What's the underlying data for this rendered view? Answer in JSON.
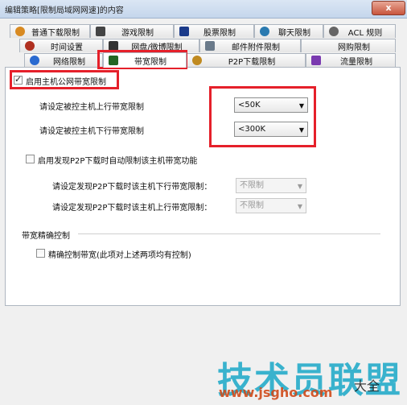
{
  "window": {
    "title": "编辑策略[限制局域网网速]的内容",
    "close_label": "x"
  },
  "tabs_row1": [
    {
      "label": "普通下载限制",
      "icon": "download-icon",
      "color": "#d88a22"
    },
    {
      "label": "游戏限制",
      "icon": "game-icon",
      "color": "#444"
    },
    {
      "label": "股票限制",
      "icon": "stock-icon",
      "color": "#1a3a8a"
    },
    {
      "label": "聊天限制",
      "icon": "chat-icon",
      "color": "#2a7ab0"
    },
    {
      "label": "ACL 规则",
      "icon": "acl-icon",
      "color": "#666"
    }
  ],
  "tabs_row2": [
    {
      "label": "时间设置",
      "icon": "clock-icon",
      "color": "#b03020"
    },
    {
      "label": "网盘/微博限制",
      "icon": "cloud-icon",
      "color": "#333"
    },
    {
      "label": "邮件附件限制",
      "icon": "mail-icon",
      "color": "#6a7a8a"
    },
    {
      "label": "网购限制",
      "icon": "shop-icon",
      "color": "#888"
    }
  ],
  "tabs_row3": [
    {
      "label": "网络限制",
      "icon": "ie-icon",
      "color": "#2a6ad0"
    },
    {
      "label": "带宽限制",
      "icon": "bandwidth-icon",
      "color": "#226622"
    },
    {
      "label": "P2P下载限制",
      "icon": "p2p-icon",
      "color": "#c08a20"
    },
    {
      "label": "流量限制",
      "icon": "traffic-icon",
      "color": "#7a3ab0"
    }
  ],
  "bandwidth": {
    "enable_label": "启用主机公网带宽限制",
    "enable_checked": true,
    "up_label": "请设定被控主机上行带宽限制",
    "up_value": "<50K",
    "down_label": "请设定被控主机下行带宽限制",
    "down_value": "<300K"
  },
  "p2p": {
    "enable_label": "启用发现P2P下载时自动限制该主机带宽功能",
    "enable_checked": false,
    "down_label": "请设定发现P2P下载时该主机下行带宽限制：",
    "down_value": "不限制",
    "up_label": "请设定发现P2P下载时该主机上行带宽限制：",
    "up_value": "不限制"
  },
  "precise": {
    "group_label": "带宽精确控制",
    "check_label": "精确控制带宽(此项对上述两项均有控制)",
    "checked": false
  },
  "watermark": {
    "main": "技术员联盟",
    "url": "www.jsgho.com",
    "suffix": "大全"
  }
}
